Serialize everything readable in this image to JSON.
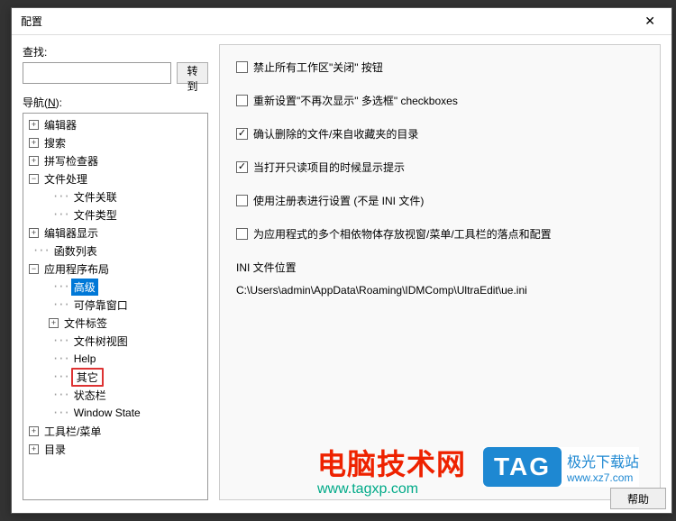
{
  "window": {
    "title": "配置"
  },
  "search": {
    "label": "查找:",
    "value": "",
    "placeholder": "",
    "goto_label": "转到"
  },
  "nav": {
    "label_prefix": "导航(",
    "label_key": "N",
    "label_suffix": "):"
  },
  "tree": [
    {
      "level": 0,
      "expand": "plus",
      "label": "编辑器"
    },
    {
      "level": 0,
      "expand": "plus",
      "label": "搜索"
    },
    {
      "level": 0,
      "expand": "plus",
      "label": "拼写检查器"
    },
    {
      "level": 0,
      "expand": "minus",
      "label": "文件处理"
    },
    {
      "level": 1,
      "expand": "none",
      "label": "文件关联"
    },
    {
      "level": 1,
      "expand": "none",
      "label": "文件类型"
    },
    {
      "level": 0,
      "expand": "plus",
      "label": "编辑器显示"
    },
    {
      "level": 0,
      "expand": "none",
      "label": "函数列表"
    },
    {
      "level": 0,
      "expand": "minus",
      "label": "应用程序布局"
    },
    {
      "level": 1,
      "expand": "none",
      "label": "高级",
      "selected": true
    },
    {
      "level": 1,
      "expand": "none",
      "label": "可停靠窗口"
    },
    {
      "level": 1,
      "expand": "plus",
      "label": "文件标签"
    },
    {
      "level": 1,
      "expand": "none",
      "label": "文件树视图"
    },
    {
      "level": 1,
      "expand": "none",
      "label": "Help"
    },
    {
      "level": 1,
      "expand": "none",
      "label": "其它",
      "highlight": true
    },
    {
      "level": 1,
      "expand": "none",
      "label": "状态栏"
    },
    {
      "level": 1,
      "expand": "none",
      "label": "Window State"
    },
    {
      "level": 0,
      "expand": "plus",
      "label": "工具栏/菜单"
    },
    {
      "level": 0,
      "expand": "plus",
      "label": "目录"
    }
  ],
  "options": [
    {
      "checked": false,
      "label": "禁止所有工作区\"关闭\" 按钮"
    },
    {
      "checked": false,
      "label": "重新设置\"不再次显示\" 多选框\" checkboxes"
    },
    {
      "checked": true,
      "label": "确认删除的文件/来自收藏夹的目录"
    },
    {
      "checked": true,
      "label": "当打开只读项目的时候显示提示"
    },
    {
      "checked": false,
      "label": "使用注册表进行设置 (不是 INI 文件)"
    },
    {
      "checked": false,
      "label": "为应用程式的多个相依物体存放视窗/菜单/工具栏的落点和配置"
    }
  ],
  "ini": {
    "section_label": "INI 文件位置",
    "path": "C:\\Users\\admin\\AppData\\Roaming\\IDMComp\\UltraEdit\\ue.ini"
  },
  "buttons": {
    "help": "帮助"
  },
  "watermarks": {
    "tagxp_cn": "电脑技术网",
    "tagxp_en": "www.tagxp.com",
    "tag_label": "TAG",
    "xz7_cn": "极光下载站",
    "xz7_en": "www.xz7.com"
  }
}
